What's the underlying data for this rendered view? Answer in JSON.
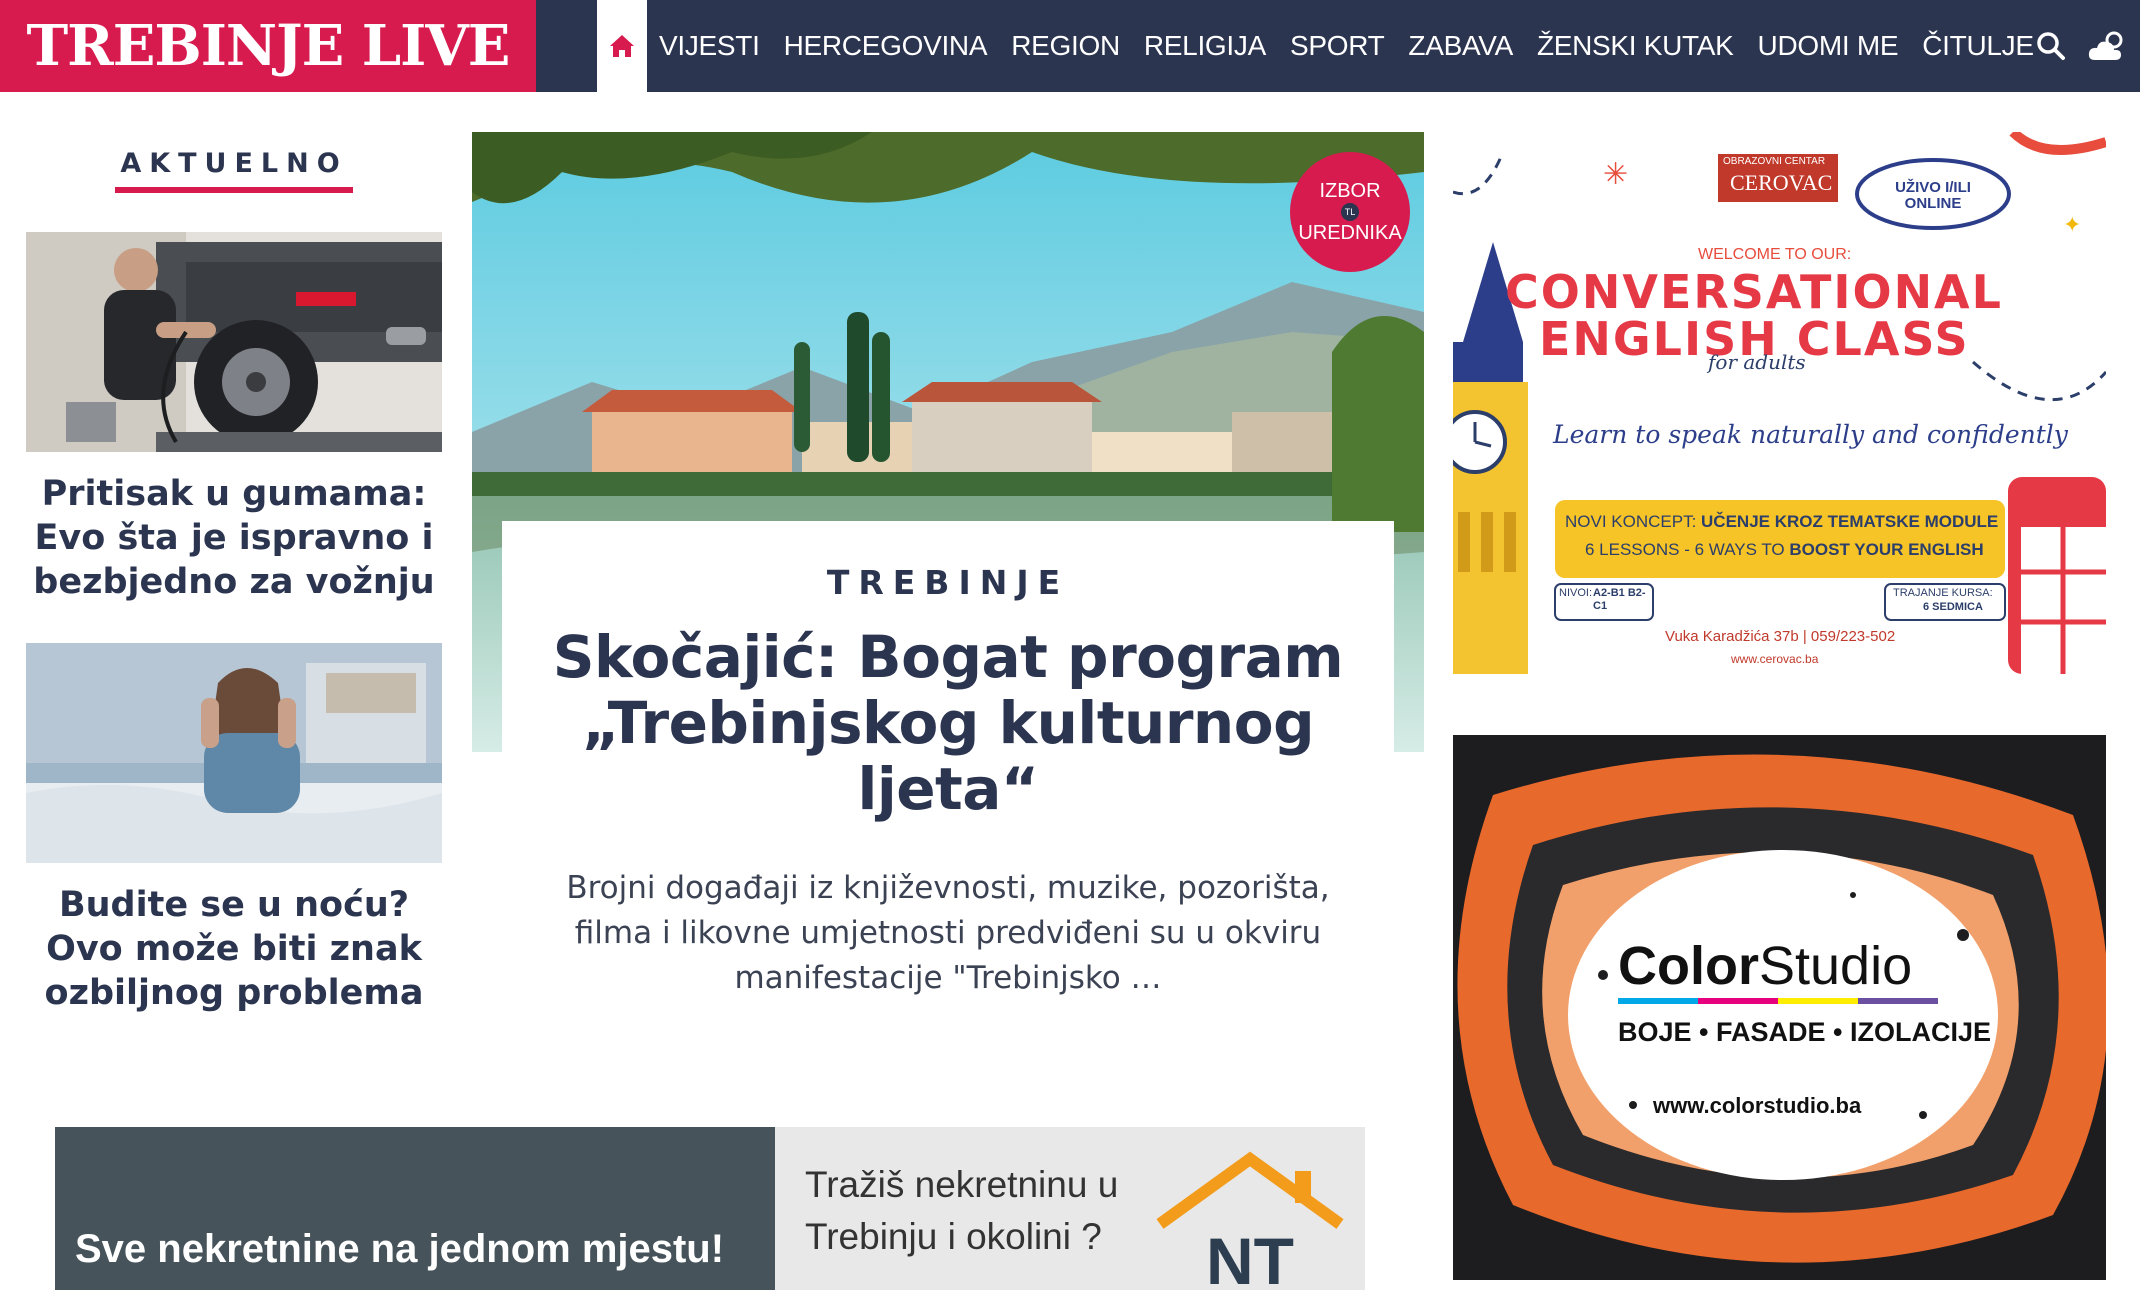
{
  "site": {
    "logo": "TREBINJE LIVE",
    "brand_color": "#d81b4f",
    "nav_color": "#2c3550"
  },
  "nav": {
    "home_icon": "home-icon",
    "items": [
      "VIJESTI",
      "HERCEGOVINA",
      "REGION",
      "RELIGIJA",
      "SPORT",
      "ZABAVA",
      "ŽENSKI KUTAK",
      "UDOMI ME",
      "ČITULJE"
    ],
    "search_icon": "search-icon",
    "weather_icon": "weather-icon"
  },
  "aktuelno": {
    "heading": "AKTUELNO",
    "articles": [
      {
        "title": "Pritisak u gumama: Evo šta je ispravno i bezbjedno za vožnju"
      },
      {
        "title": "Budite se u noću? Ovo može biti znak ozbiljnog problema"
      }
    ]
  },
  "featured": {
    "badge_line1": "IZBOR",
    "badge_mark": "TL",
    "badge_line2": "UREDNIKA",
    "category": "TREBINJE",
    "title": "Skočajić: Bogat program „Trebinjskog kulturnog ljeta“",
    "excerpt": "Brojni događaji iz književnosti, muzike, pozorišta, filma i likovne umjetnosti predviđeni su u okviru manifestacije \"Trebinjsko …"
  },
  "ads": {
    "english": {
      "school_top": "OBRAZOVNI CENTAR",
      "school": "CEROVAC",
      "mode": "UŽIVO I/ILI ONLINE",
      "welcome": "WELCOME TO OUR:",
      "title_line1": "CONVERSATIONAL",
      "title_line2": "ENGLISH CLASS",
      "for_adults": "for adults",
      "tagline": "Learn to speak naturally and confidently",
      "concept_prefix": "NOVI KONCEPT: ",
      "concept": "UČENJE KROZ TEMATSKE MODULE",
      "lessons_prefix": "6 LESSONS - 6 WAYS TO ",
      "lessons": "BOOST YOUR ENGLISH",
      "levels_label": "NIVOI:",
      "levels": "A2-B1 B2-C1",
      "duration_label": "TRAJANJE KURSA:",
      "duration": "6 SEDMICA",
      "address": "Vuka Karadžića 37b | 059/223-502",
      "web": "www.cerovac.ba"
    },
    "color_studio": {
      "name_bold": "Color",
      "name_light": "Studio",
      "services": "BOJE • FASADE • IZOLACIJE",
      "web": "www.colorstudio.ba"
    },
    "realestate": {
      "slogan": "Sve nekretnine na jednom mjestu!",
      "question_line1": "Tražiš nekretninu u",
      "question_line2": "Trebinju i okolini ?",
      "logo": "NT"
    }
  }
}
